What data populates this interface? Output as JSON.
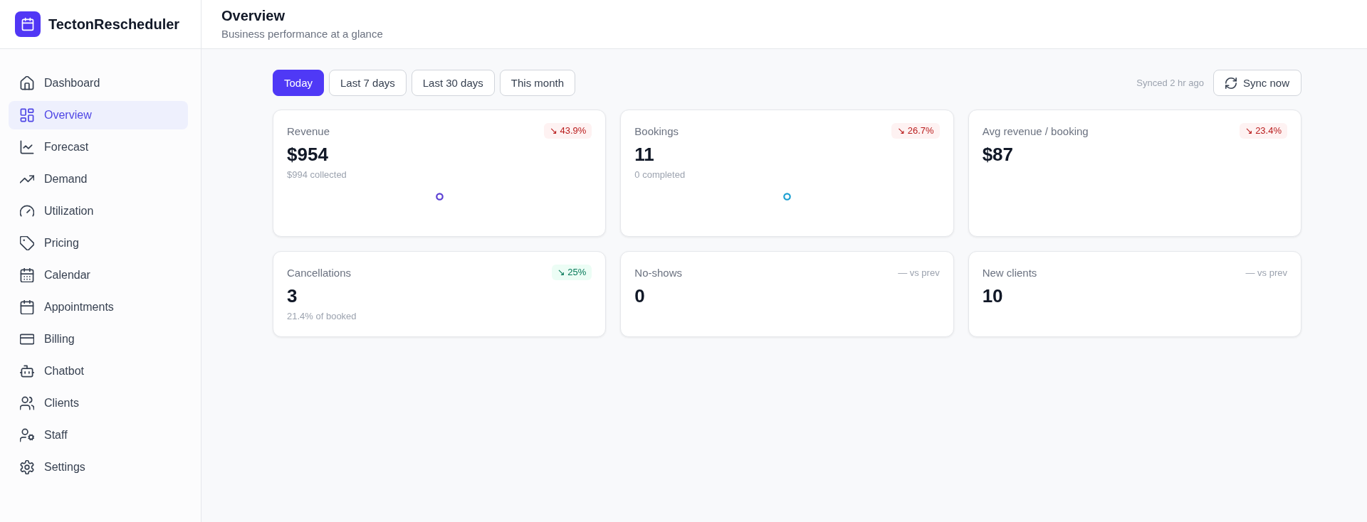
{
  "brand": {
    "name": "TectonRescheduler"
  },
  "sidebar": {
    "items": [
      {
        "label": "Dashboard",
        "selected": false
      },
      {
        "label": "Overview",
        "selected": true
      },
      {
        "label": "Forecast",
        "selected": false
      },
      {
        "label": "Demand",
        "selected": false
      },
      {
        "label": "Utilization",
        "selected": false
      },
      {
        "label": "Pricing",
        "selected": false
      },
      {
        "label": "Calendar",
        "selected": false
      },
      {
        "label": "Appointments",
        "selected": false
      },
      {
        "label": "Billing",
        "selected": false
      },
      {
        "label": "Chatbot",
        "selected": false
      },
      {
        "label": "Clients",
        "selected": false
      },
      {
        "label": "Staff",
        "selected": false
      },
      {
        "label": "Settings",
        "selected": false
      }
    ]
  },
  "header": {
    "title": "Overview",
    "subtitle": "Business performance at a glance"
  },
  "range_tabs": [
    {
      "label": "Today",
      "selected": true
    },
    {
      "label": "Last 7 days",
      "selected": false
    },
    {
      "label": "Last 30 days",
      "selected": false
    },
    {
      "label": "This month",
      "selected": false
    }
  ],
  "sync": {
    "status": "Synced 2 hr ago",
    "button": "Sync now"
  },
  "metrics": [
    {
      "label": "Revenue",
      "value": "$954",
      "note": "$994 collected",
      "change": {
        "kind": "negative",
        "text": "↘ 43.9%"
      },
      "color": "#5b3fd3"
    },
    {
      "label": "Bookings",
      "value": "11",
      "note": "0 completed",
      "change": {
        "kind": "negative",
        "text": "↘ 26.7%"
      },
      "color": "#1b9fd1"
    },
    {
      "label": "Avg revenue / booking",
      "value": "$87",
      "change": {
        "kind": "negative",
        "text": "↘ 23.4%"
      }
    },
    {
      "label": "Cancellations",
      "value": "3",
      "note": "21.4% of booked",
      "change": {
        "kind": "positive",
        "text": "↘ 25%"
      }
    },
    {
      "label": "No-shows",
      "value": "0",
      "change": {
        "kind": "neutral",
        "text": "— vs prev"
      }
    },
    {
      "label": "New clients",
      "value": "10",
      "change": {
        "kind": "neutral",
        "text": "— vs prev"
      }
    }
  ]
}
